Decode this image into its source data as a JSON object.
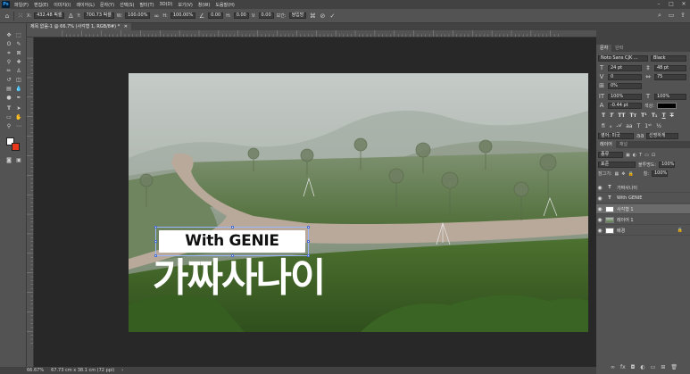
{
  "menu": {
    "items": [
      "파일(F)",
      "편집(E)",
      "이미지(I)",
      "레이어(L)",
      "문자(Y)",
      "선택(S)",
      "필터(T)",
      "3D(D)",
      "보기(V)",
      "창(W)",
      "도움말(H)"
    ]
  },
  "options": {
    "x_label": "X:",
    "x_value": "432.48 픽셀",
    "y_label": "Y:",
    "y_value": "700.73 픽셀",
    "w_label": "W:",
    "w_value": "100.00%",
    "h_label": "H:",
    "h_value": "100.00%",
    "angle_value": "0.00",
    "hskew_label": "H:",
    "hskew_value": "0.00",
    "vskew_label": "V:",
    "vskew_value": "0.00",
    "interp_label": "보간:",
    "interp_value": "쌍입방"
  },
  "document": {
    "tab_title": "제목 없음-1 @ 66.7% (사각형 1, RGB/8#) *"
  },
  "canvas": {
    "title_en": "With GENIE",
    "title_ko": "가짜사나이"
  },
  "status": {
    "zoom": "66.67%",
    "doc_size": "67.73 cm x 38.1 cm (72 ppi)"
  },
  "character_panel": {
    "tabs": [
      "문자",
      "단락"
    ],
    "font_family": "Noto Sans CJK ...",
    "font_style": "Black",
    "size": "24 pt",
    "leading": "48 pt",
    "kerning": "0",
    "tracking": "75",
    "scale": "0%",
    "v_scale": "100%",
    "h_scale": "100%",
    "baseline": "-0.44 pt",
    "color_label": "색상:",
    "lang": "영어: 미국",
    "aa": "선명하게"
  },
  "layers_panel": {
    "tabs": [
      "레이어",
      "채널"
    ],
    "filter": "종류",
    "blend_mode": "표준",
    "opacity_label": "불투명도:",
    "opacity": "100%",
    "lock_label": "잠그기:",
    "fill_label": "칠:",
    "fill": "100%",
    "layers": [
      {
        "name": "가짜사나이",
        "type": "text",
        "selected": false
      },
      {
        "name": "With GENIE",
        "type": "text",
        "selected": false
      },
      {
        "name": "사각형 1",
        "type": "shape",
        "selected": true
      },
      {
        "name": "레이어 1",
        "type": "image",
        "selected": false
      },
      {
        "name": "배경",
        "type": "background",
        "selected": false
      }
    ]
  },
  "colors": {
    "foreground": "#ffffff",
    "background": "#e8381c"
  }
}
